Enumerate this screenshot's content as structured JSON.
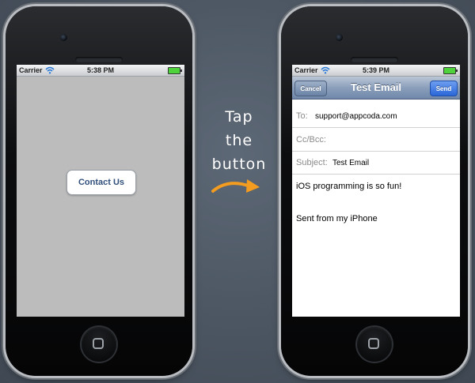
{
  "left_phone": {
    "status_bar": {
      "carrier": "Carrier",
      "time": "5:38 PM"
    },
    "contact_button_label": "Contact Us"
  },
  "annotation": {
    "lines": [
      "Tap",
      "the",
      "button"
    ],
    "arrow_color": "#f39c1f"
  },
  "right_phone": {
    "status_bar": {
      "carrier": "Carrier",
      "time": "5:39 PM"
    },
    "nav": {
      "title": "Test Email",
      "cancel_label": "Cancel",
      "send_label": "Send"
    },
    "fields": {
      "to_label": "To:",
      "to_value": "support@appcoda.com",
      "cc_label": "Cc/Bcc:",
      "subject_label": "Subject:",
      "subject_value": "Test Email"
    },
    "body": {
      "line1": "iOS programming is so fun!",
      "line2": "Sent from my iPhone"
    }
  },
  "colors": {
    "send_button": "#2a66d8",
    "battery": "#4ed33c",
    "left_screen_bg": "#bcbcbc"
  },
  "icons": [
    "wifi-icon",
    "battery-icon",
    "home-button",
    "arrow-icon"
  ]
}
